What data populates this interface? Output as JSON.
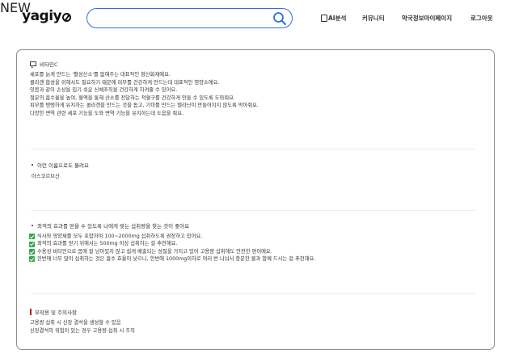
{
  "header": {
    "logo_text": "yagiy",
    "search": {
      "placeholder": "",
      "value": ""
    },
    "nav": {
      "ai_label": "AI분석",
      "ai_badge": "NEW",
      "community_label": "커뮤니티",
      "mypage_label": "약국정보마이페이지",
      "login_label": "로그아웃"
    }
  },
  "sections": {
    "vitamin": {
      "title": "비타민C",
      "lines": [
        "세포를 늙게 만드는 '활성산소'를 없애주는 대표적인 항산화제예요.",
        "콜라겐 합성을 위해서도 필요하기 때문에 피부를 건강하게 만드는데 대표적인 영양소에요.",
        "잇몸과 같이 손상을 입기 쉬운 신체조직을 건강하게 지켜줄 수 있어요.",
        "철분의 흡수율을 높여, 혈액을 통해 산소를 전달하는 적혈구를 건강하게 만들 수 있도록 도와줘요.",
        "피부를 탱탱하게 유지하는 콜라겐을 만드는 것을 돕고, 기미를 만드는 멜라닌이 만들어지지 않도록 막아줘요.",
        "다양한 면역 관련 세포 기능을 도와 면역 기능을 유지하는데 도움을 줘요."
      ]
    },
    "aliases": {
      "title": "이런 이름으로도 불려요",
      "value": "아스코르브산"
    },
    "dosage": {
      "title": "최적의 효과를 얻을 수 있도록 나에게 맞는 섭취량을 찾는 것이 좋아요",
      "items": [
        "식사와 영양제를 모두 포함하여 100~2000mg 섭취하도록 권장하고 있어요.",
        "최적의 효과를 얻기 위해서는 500mg 이상 섭취하는 걸 추천해요.",
        "수용성 비타민으로 몸에 잘 남아있지 않고 쉽게 배출되는 성질을 가지고 있어 고용량 섭취해도 안전한 편이에요.",
        "한번에 너무 많이 섭취하는 것은 흡수 효율이 낮으니, 한번에 1000mg이하로 여러 번 나눠서 충분한 물과 함께 드시는 걸 추천해요."
      ]
    },
    "side_effects": {
      "title": "부작용 및 주의사항",
      "lines": [
        "고용량 섭취 시 신장 결석을 생성할 수 있음",
        "신장결석의 위험이 있는 경우 고용량 섭취 시 주의"
      ]
    }
  },
  "colors": {
    "accent": "#2f6fe0",
    "check_green": "#2ea84a",
    "warning_bar": "#b02020",
    "badge": "#e8452c"
  }
}
